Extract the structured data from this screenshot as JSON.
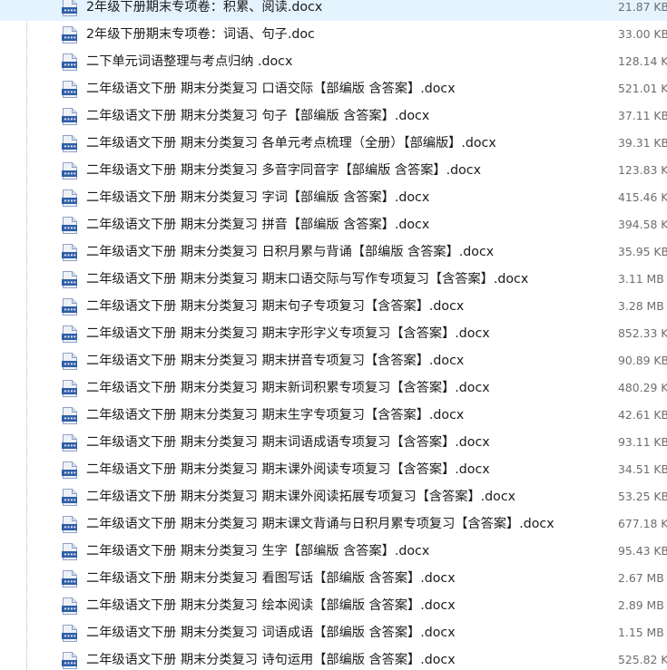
{
  "icon": "docx-document-icon",
  "colors": {
    "icon_blue": "#2f5ea8",
    "icon_paper": "#eef2f8",
    "name_text": "#1a1a1a",
    "size_text": "#6d6d6d"
  },
  "files": [
    {
      "name": "2年级下册期末专项卷：积累、阅读.docx",
      "size": "21.87 KB"
    },
    {
      "name": "2年级下册期末专项卷：词语、句子.doc",
      "size": "33.00 KB"
    },
    {
      "name": "二下单元词语整理与考点归纳 .docx",
      "size": "128.14 KB"
    },
    {
      "name": "二年级语文下册 期末分类复习 口语交际【部编版 含答案】.docx",
      "size": "521.01 KB"
    },
    {
      "name": "二年级语文下册 期末分类复习 句子【部编版 含答案】.docx",
      "size": "37.11 KB"
    },
    {
      "name": "二年级语文下册 期末分类复习 各单元考点梳理（全册）【部编版】.docx",
      "size": "39.31 KB"
    },
    {
      "name": "二年级语文下册 期末分类复习 多音字同音字【部编版 含答案】.docx",
      "size": "123.83 KB"
    },
    {
      "name": "二年级语文下册 期末分类复习 字词【部编版 含答案】.docx",
      "size": "415.46 KB"
    },
    {
      "name": "二年级语文下册 期末分类复习 拼音【部编版 含答案】.docx",
      "size": "394.58 KB"
    },
    {
      "name": "二年级语文下册 期末分类复习 日积月累与背诵【部编版 含答案】.docx",
      "size": "35.95 KB"
    },
    {
      "name": "二年级语文下册 期末分类复习 期末口语交际与写作专项复习【含答案】.docx",
      "size": "3.11 MB"
    },
    {
      "name": "二年级语文下册 期末分类复习 期末句子专项复习【含答案】.docx",
      "size": "3.28 MB"
    },
    {
      "name": "二年级语文下册 期末分类复习 期末字形字义专项复习【含答案】.docx",
      "size": "852.33 KB"
    },
    {
      "name": "二年级语文下册 期末分类复习 期末拼音专项复习【含答案】.docx",
      "size": "90.89 KB"
    },
    {
      "name": "二年级语文下册 期末分类复习 期末新词积累专项复习【含答案】.docx",
      "size": "480.29 KB"
    },
    {
      "name": "二年级语文下册 期末分类复习 期末生字专项复习【含答案】.docx",
      "size": "42.61 KB"
    },
    {
      "name": "二年级语文下册 期末分类复习 期末词语成语专项复习【含答案】.docx",
      "size": "93.11 KB"
    },
    {
      "name": "二年级语文下册 期末分类复习 期末课外阅读专项复习【含答案】.docx",
      "size": "34.51 KB"
    },
    {
      "name": "二年级语文下册 期末分类复习 期末课外阅读拓展专项复习【含答案】.docx",
      "size": "53.25 KB"
    },
    {
      "name": "二年级语文下册 期末分类复习 期末课文背诵与日积月累专项复习【含答案】.docx",
      "size": "677.18 KB"
    },
    {
      "name": "二年级语文下册 期末分类复习 生字【部编版 含答案】.docx",
      "size": "95.43 KB"
    },
    {
      "name": "二年级语文下册 期末分类复习 看图写话【部编版 含答案】.docx",
      "size": "2.67 MB"
    },
    {
      "name": "二年级语文下册 期末分类复习 绘本阅读【部编版 含答案】.docx",
      "size": "2.89 MB"
    },
    {
      "name": "二年级语文下册 期末分类复习 词语成语【部编版 含答案】.docx",
      "size": "1.15 MB"
    },
    {
      "name": "二年级语文下册 期末分类复习 诗句运用【部编版 含答案】.docx",
      "size": "525.82 KB"
    }
  ]
}
